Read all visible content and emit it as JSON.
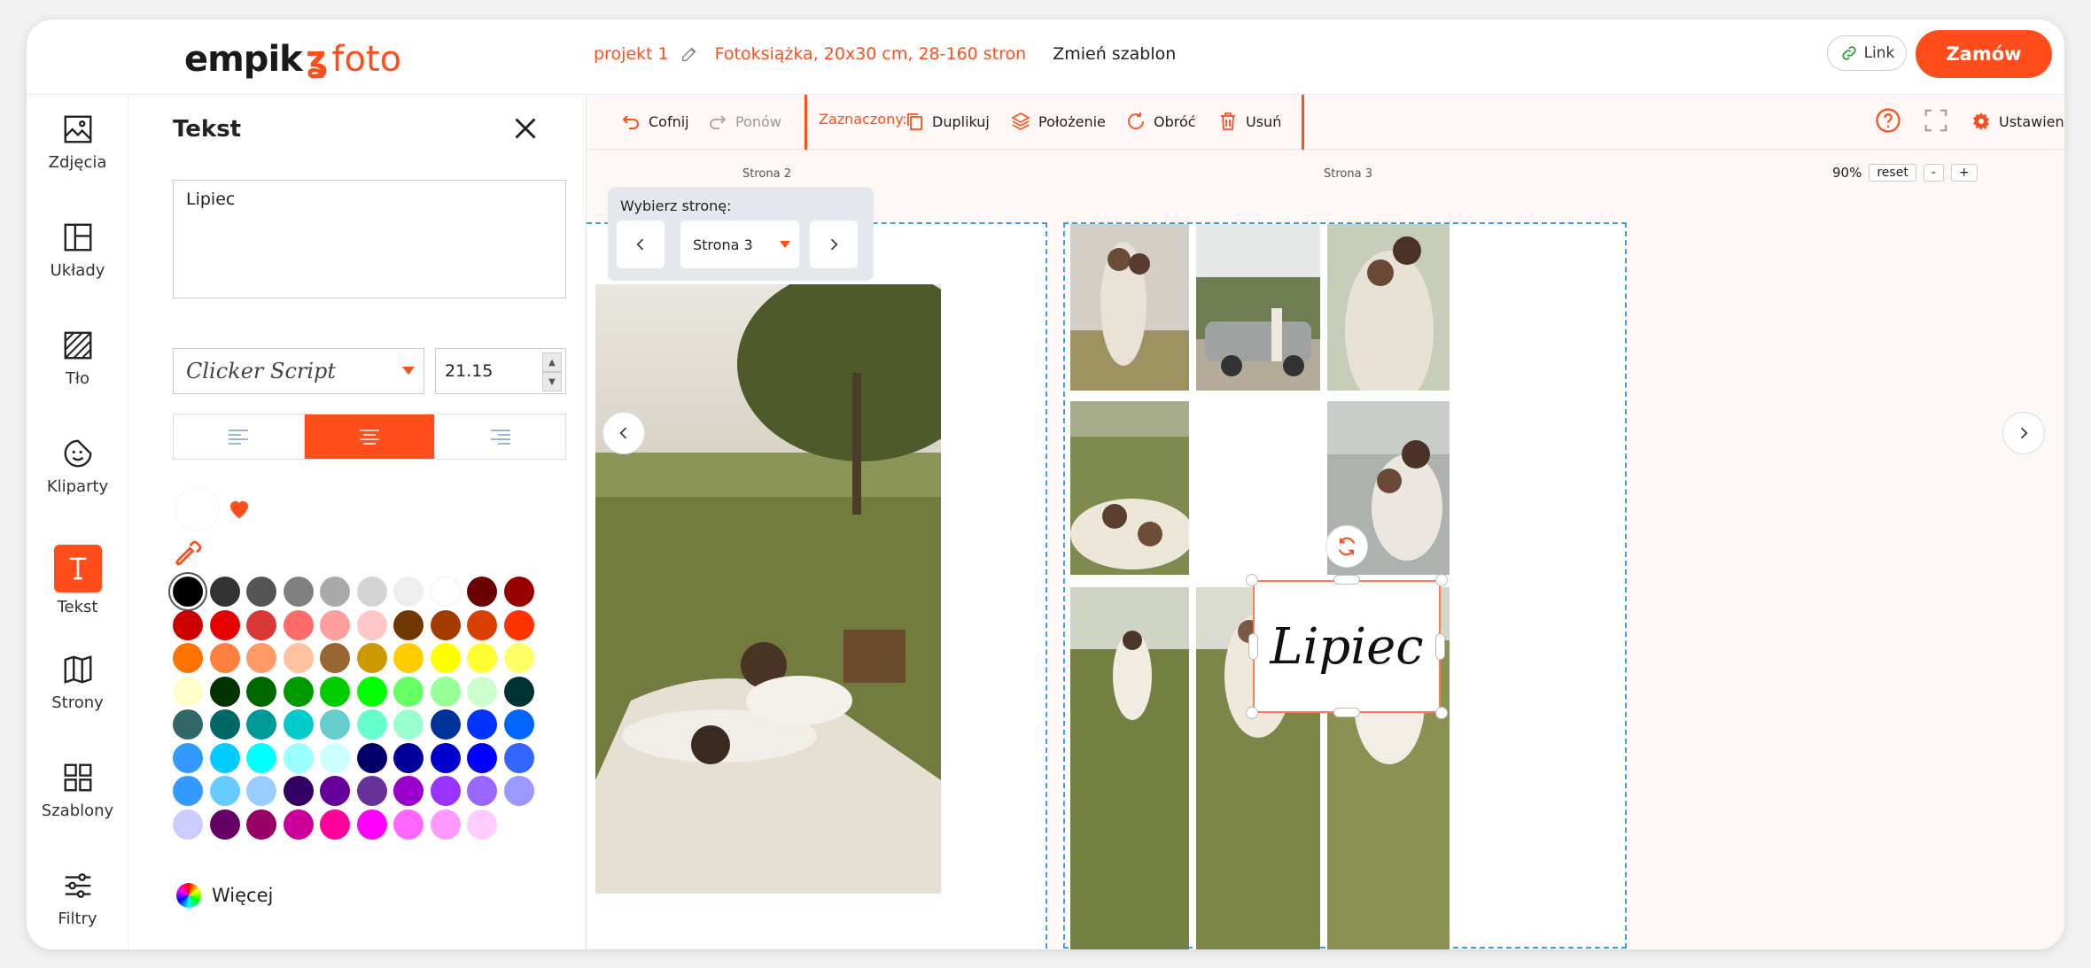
{
  "header": {
    "logo_word1": "empik",
    "logo_word2": "foto",
    "project_name": "projekt 1",
    "project_desc": "Fotoksiążka, 20x30 cm, 28-160 stron",
    "change_template": "Zmień szablon",
    "link_label": "Link",
    "order_label": "Zamów"
  },
  "iconbar": {
    "items": [
      {
        "label": "Zdjęcia",
        "icon": "image-icon"
      },
      {
        "label": "Układy",
        "icon": "layout-icon"
      },
      {
        "label": "Tło",
        "icon": "background-icon"
      },
      {
        "label": "Kliparty",
        "icon": "sticker-icon"
      },
      {
        "label": "Tekst",
        "icon": "text-icon"
      },
      {
        "label": "Strony",
        "icon": "book-icon"
      },
      {
        "label": "Szablony",
        "icon": "grid-icon"
      },
      {
        "label": "Filtry",
        "icon": "sliders-icon"
      }
    ]
  },
  "panel": {
    "title": "Tekst",
    "text_value": "Lipiec",
    "font_name": "Clicker Script",
    "font_size": "21.15",
    "more_colors": "Więcej",
    "palette": [
      "#000000",
      "#333333",
      "#555555",
      "#808080",
      "#aaaaaa",
      "#d4d4d4",
      "#eeeeee",
      "#ffffff",
      "#6b0000",
      "#990000",
      "#cc0000",
      "#e60000",
      "#d93838",
      "#ff6b6b",
      "#ff9e9e",
      "#ffc7c7",
      "#703800",
      "#a33b00",
      "#d94000",
      "#ff3300",
      "#ff7300",
      "#ff7f3f",
      "#ff9966",
      "#ffc29e",
      "#996633",
      "#cc9900",
      "#ffcc00",
      "#ffff00",
      "#ffff33",
      "#ffff66",
      "#ffffcc",
      "#003300",
      "#006600",
      "#009900",
      "#00cc00",
      "#00ff00",
      "#66ff66",
      "#99ff99",
      "#ccffcc",
      "#003333",
      "#336666",
      "#006666",
      "#009999",
      "#00cccc",
      "#66cccc",
      "#66ffcc",
      "#99ffcc",
      "#003399",
      "#0033ff",
      "#0066ff",
      "#3399ff",
      "#00ccff",
      "#00ffff",
      "#99ffff",
      "#ccffff",
      "#000066",
      "#000099",
      "#0000cc",
      "#0000ff",
      "#3366ff",
      "#3399ff",
      "#66ccff",
      "#99ccff",
      "#330066",
      "#660099",
      "#663399",
      "#9900cc",
      "#9933ff",
      "#9966ff",
      "#9999ff",
      "#ccccff",
      "#660066",
      "#990066",
      "#cc0099",
      "#ff0099",
      "#ff00ff",
      "#ff66ff",
      "#ff99ff",
      "#ffccff"
    ],
    "accent": "#ff4e1c"
  },
  "toolbar": {
    "undo": "Cofnij",
    "redo": "Ponów",
    "selected": "Zaznaczony:",
    "duplicate": "Duplikuj",
    "position": "Położenie",
    "rotate": "Obróć",
    "delete": "Usuń",
    "settings": "Ustawienia"
  },
  "canvas": {
    "page2_label": "Strona 2",
    "page3_label": "Strona 3",
    "choose_page": "Wybierz stronę:",
    "selected_page": "Strona 3",
    "zoom": "90%",
    "reset": "reset",
    "zoom_out": "-",
    "zoom_in": "+",
    "textbox_text": "Lipiec"
  }
}
